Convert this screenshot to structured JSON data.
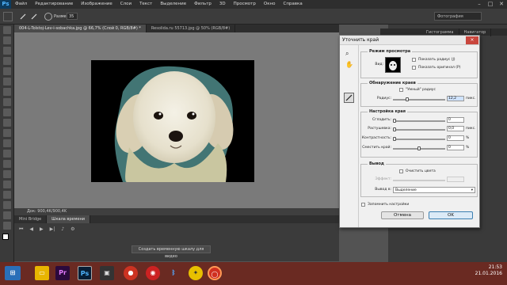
{
  "menu": {
    "logo": "Ps",
    "items": [
      "Файл",
      "Редактирование",
      "Изображение",
      "Слои",
      "Текст",
      "Выделение",
      "Фильтр",
      "3D",
      "Просмотр",
      "Окно",
      "Справка"
    ]
  },
  "options": {
    "size_label": "Размер:",
    "size_value": "35",
    "workspace": "Фотография"
  },
  "tabs": [
    {
      "label": "004-L-Tolstoj-Lev-i-sobachka.jpg @ 66,7% (Слой 0, RGB/8#) *",
      "active": true
    },
    {
      "label": "Resolida.ru 55713.jpg @ 50% (RGB/8#)",
      "active": false
    }
  ],
  "status": {
    "zoom": "66,67%",
    "doc": "Док: 900,4K/900,4K"
  },
  "timeline": {
    "tabs": [
      "Mini Bridge",
      "Шкала времени"
    ],
    "create_button": "Создать временную шкалу для видео"
  },
  "panels": {
    "tabs": [
      "Гистограмма",
      "Навигатор"
    ]
  },
  "dialog": {
    "title": "Уточнить край",
    "close": "×",
    "view_mode": {
      "title": "Режим просмотра",
      "view_label": "Вид:",
      "show_radius": "Показать радиус (J)",
      "show_original": "Показать оригинал (P)"
    },
    "edge_detect": {
      "title": "Обнаружение краев",
      "smart_radius": "\"Умный\" радиус",
      "radius_label": "Радиус:",
      "radius_value": "12,2",
      "radius_unit": "пикс.",
      "radius_level": 0.25
    },
    "adjust": {
      "title": "Настройка края",
      "rows": [
        {
          "label": "Сгладить:",
          "value": "0",
          "unit": "",
          "level": 0
        },
        {
          "label": "Растушевка:",
          "value": "0,0",
          "unit": "пикс.",
          "level": 0
        },
        {
          "label": "Контрастность:",
          "value": "0",
          "unit": "%",
          "level": 0
        },
        {
          "label": "Сместить край:",
          "value": "0",
          "unit": "%",
          "level": 0.5
        }
      ]
    },
    "output": {
      "title": "Вывод",
      "decontaminate": "Очистить цвета",
      "amount_label": "Эффект:",
      "output_label": "Вывод в:",
      "output_value": "Выделение"
    },
    "remember": "Запомнить настройки",
    "cancel": "Отмена",
    "ok": "OK"
  },
  "taskbar": {
    "apps": [
      "Pr",
      "Ps"
    ],
    "time": "21:53",
    "date": "21.01.2016"
  }
}
